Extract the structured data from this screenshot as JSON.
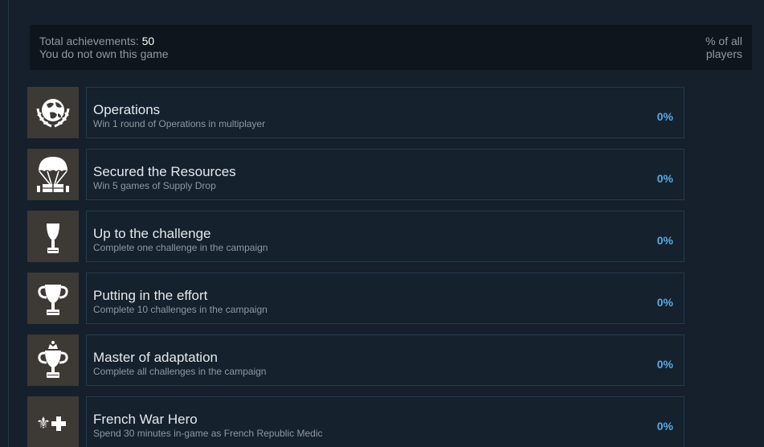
{
  "summary": {
    "total_label": "Total achievements:",
    "total_value": "50",
    "ownership_note": "You do not own this game",
    "pct_header_line1": "% of all",
    "pct_header_line2": "players"
  },
  "achievements": [
    {
      "icon": "globe-laurel-icon",
      "title": "Operations",
      "description": "Win 1 round of Operations in multiplayer",
      "percent": "0%"
    },
    {
      "icon": "parachute-crate-icon",
      "title": "Secured the Resources",
      "description": "Win 5 games of Supply Drop",
      "percent": "0%"
    },
    {
      "icon": "small-trophy-icon",
      "title": "Up to the challenge",
      "description": "Complete one challenge in the campaign",
      "percent": "0%"
    },
    {
      "icon": "trophy-icon",
      "title": "Putting in the effort",
      "description": "Complete 10 challenges in the campaign",
      "percent": "0%"
    },
    {
      "icon": "crowned-trophy-icon",
      "title": "Master of adaptation",
      "description": "Complete all challenges in the campaign",
      "percent": "0%"
    },
    {
      "icon": "fleur-de-lis-cross-icon",
      "title": "French War Hero",
      "description": "Spend 30 minutes in-game as French Republic Medic",
      "percent": "0%"
    }
  ]
}
